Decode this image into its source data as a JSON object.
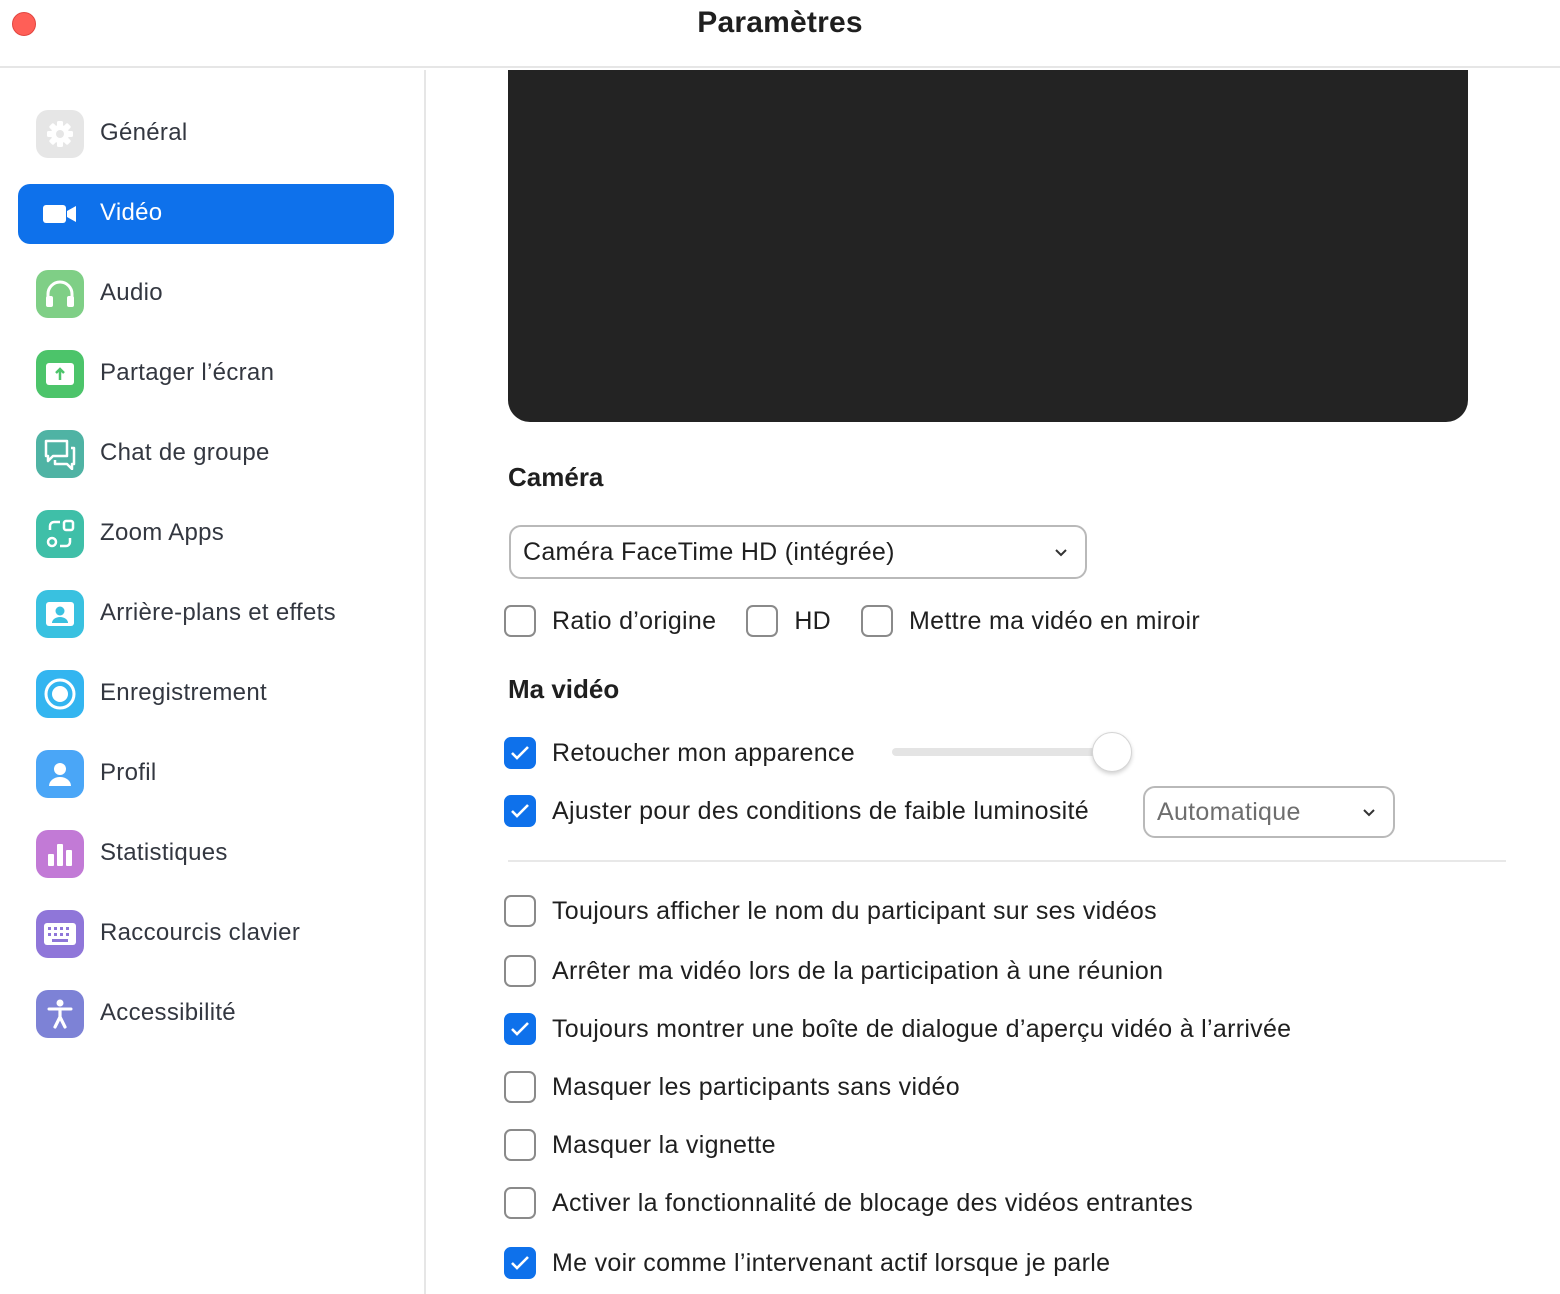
{
  "window": {
    "title": "Paramètres"
  },
  "sidebar": {
    "items": [
      {
        "label": "Général",
        "icon": "gear-icon",
        "color": "#e6e6e6",
        "active": false
      },
      {
        "label": "Vidéo",
        "icon": "video-camera-icon",
        "color": "#0e71eb",
        "active": true
      },
      {
        "label": "Audio",
        "icon": "headphones-icon",
        "color": "#7fcf86",
        "active": false
      },
      {
        "label": "Partager l’écran",
        "icon": "share-screen-icon",
        "color": "#4cc46a",
        "active": false
      },
      {
        "label": "Chat de groupe",
        "icon": "chat-bubbles-icon",
        "color": "#4fb3a4",
        "active": false
      },
      {
        "label": "Zoom Apps",
        "icon": "apps-icon",
        "color": "#3fbfa8",
        "active": false
      },
      {
        "label": "Arrière-plans et effets",
        "icon": "background-person-icon",
        "color": "#39c1e0",
        "active": false
      },
      {
        "label": "Enregistrement",
        "icon": "record-icon",
        "color": "#33b5f0",
        "active": false
      },
      {
        "label": "Profil",
        "icon": "profile-icon",
        "color": "#4aa6f7",
        "active": false
      },
      {
        "label": "Statistiques",
        "icon": "bar-chart-icon",
        "color": "#c27ad6",
        "active": false
      },
      {
        "label": "Raccourcis clavier",
        "icon": "keyboard-icon",
        "color": "#8f76d9",
        "active": false
      },
      {
        "label": "Accessibilité",
        "icon": "accessibility-icon",
        "color": "#7d82d6",
        "active": false
      }
    ]
  },
  "camera": {
    "title": "Caméra",
    "selected": "Caméra FaceTime HD (intégrée)",
    "options": [
      {
        "label": "Ratio d’origine",
        "checked": false
      },
      {
        "label": "HD",
        "checked": false
      },
      {
        "label": "Mettre ma vidéo en miroir",
        "checked": false
      }
    ]
  },
  "my_video": {
    "title": "Ma vidéo",
    "touch_up": {
      "label": "Retoucher mon apparence",
      "checked": true,
      "level": 1.0
    },
    "low_light": {
      "label": "Ajuster pour des conditions de faible luminosité",
      "checked": true,
      "selected": "Automatique"
    }
  },
  "options": [
    {
      "label": "Toujours afficher le nom du participant sur ses vidéos",
      "checked": false
    },
    {
      "label": "Arrêter ma vidéo lors de la participation à une réunion",
      "checked": false
    },
    {
      "label": "Toujours montrer une boîte de dialogue d’aperçu vidéo à l’arrivée",
      "checked": true
    },
    {
      "label": "Masquer les participants sans vidéo",
      "checked": false
    },
    {
      "label": "Masquer la vignette",
      "checked": false
    },
    {
      "label": "Activer la fonctionnalité de blocage des vidéos entrantes",
      "checked": false
    },
    {
      "label": "Me voir comme l’intervenant actif lorsque je parle",
      "checked": true
    }
  ],
  "colors": {
    "accent": "#0e71eb",
    "preview_bg": "#232323",
    "close_button": "#ff5f57"
  }
}
